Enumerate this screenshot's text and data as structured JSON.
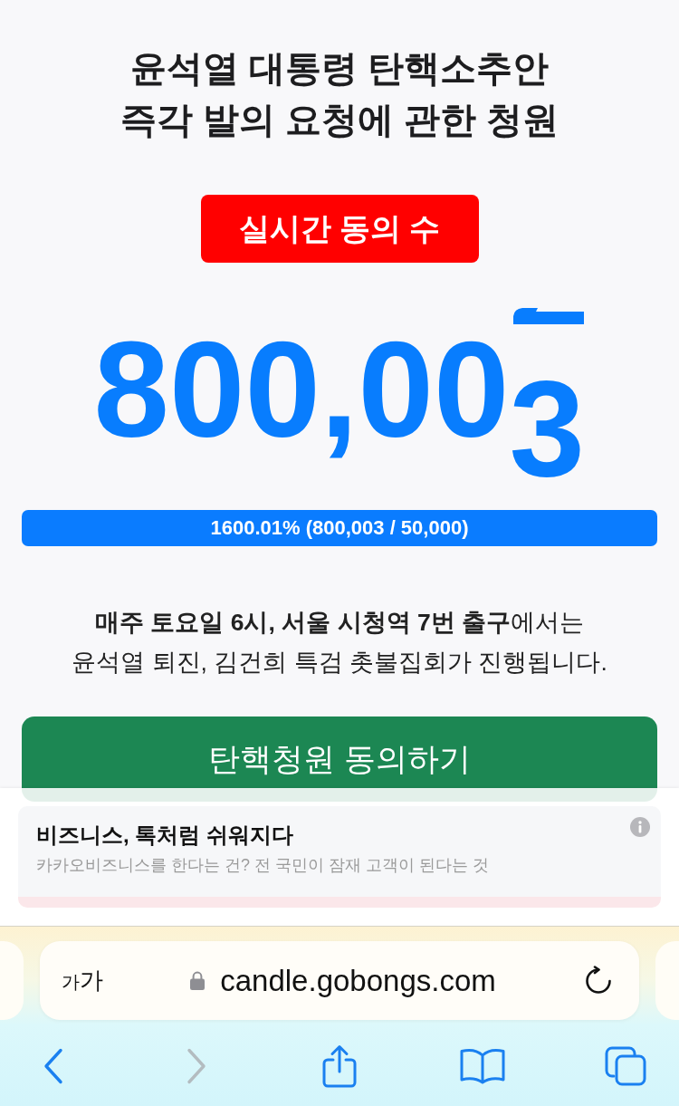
{
  "title": {
    "lines": [
      "윤석열 대통령 탄핵소추안",
      "즉각 발의 요청에 관한 청원"
    ]
  },
  "live_badge": "실시간 동의 수",
  "counter": {
    "value": "800,00",
    "rolling_digit": "3"
  },
  "progress": {
    "level": 1,
    "label": "1600.01% (800,003 / 50,000)"
  },
  "notice": {
    "lines": [
      "**매주 토요일 6시, 서울 시청역 7번 출구**에서는",
      "윤석열 퇴진, 김건희 특검 촛불집회가 진행됩니다."
    ]
  },
  "agree_button": "탄핵청원 동의하기",
  "ad": {
    "title": "비즈니스, 톡처럼 쉬워지다",
    "text": "카카오비즈니스를 한다는 건? 전 국민이 잠재 고객이 된다는 것"
  },
  "browser": {
    "text_size_button": "가가",
    "url": "candle.gobongs.com",
    "secure": true,
    "toolbar": [
      {
        "kind": "back",
        "disabled": false
      },
      {
        "kind": "forward",
        "disabled": true
      },
      {
        "kind": "share",
        "disabled": false
      },
      {
        "kind": "bookmarks",
        "disabled": false
      },
      {
        "kind": "tabs",
        "disabled": false
      }
    ]
  }
}
